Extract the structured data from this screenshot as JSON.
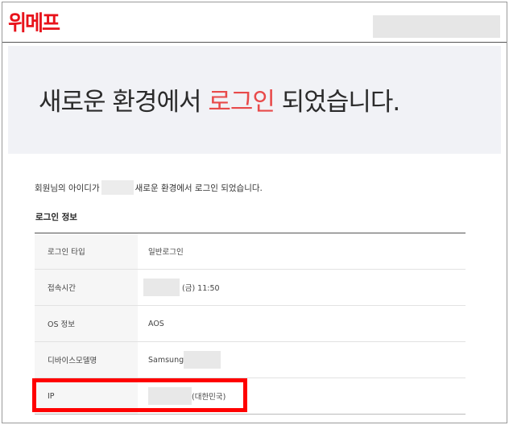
{
  "brand": {
    "logo_text": "위메프",
    "accent_color": "#e8131b"
  },
  "hero": {
    "title_before": "새로운 환경에서 ",
    "title_accent": "로그인",
    "title_after": " 되었습니다.",
    "accent_color": "#e84a4a"
  },
  "message": {
    "before": "회원님의 아이디가",
    "after": "새로운 환경에서 로그인 되었습니다."
  },
  "section_title": "로그인 정보",
  "rows": [
    {
      "label": "로그인 타입",
      "value": "일반로그인"
    },
    {
      "label": "접속시간",
      "value": "(금) 11:50"
    },
    {
      "label": "OS 정보",
      "value": "AOS"
    },
    {
      "label": "디바이스모델명",
      "value": "Samsung"
    },
    {
      "label": "IP",
      "value": "(대한민국)"
    }
  ],
  "highlight_color": "#ff0000"
}
